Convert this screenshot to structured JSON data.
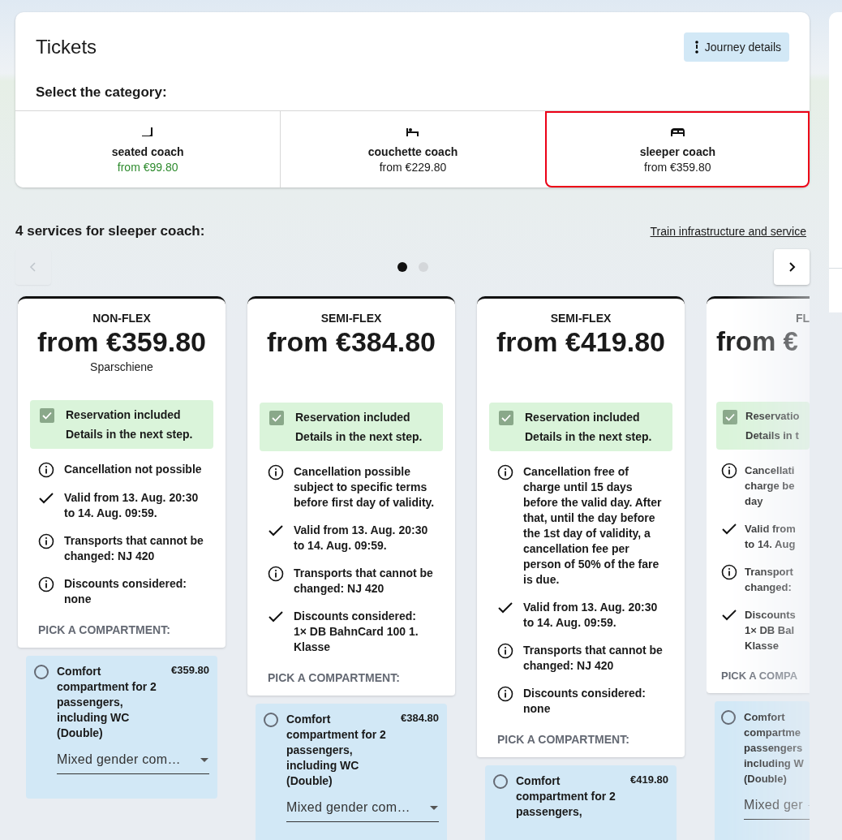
{
  "header": {
    "title": "Tickets",
    "journey_button": "Journey details",
    "category_prompt": "Select the category:"
  },
  "categories": [
    {
      "kind": "seat",
      "name": "seated coach",
      "price": "from €99.80",
      "best_price": true,
      "selected": false
    },
    {
      "kind": "couchette",
      "name": "couchette coach",
      "price": "from €229.80",
      "best_price": false,
      "selected": false
    },
    {
      "kind": "sleeper",
      "name": "sleeper coach",
      "price": "from €359.80",
      "best_price": false,
      "selected": true
    }
  ],
  "services": {
    "heading": "4 services for sleeper coach:",
    "link": "Train infrastructure and service",
    "prev_disabled": true,
    "next_disabled": false,
    "page_dots": [
      {
        "selected": true
      },
      {
        "selected": false
      }
    ]
  },
  "offers": [
    {
      "tier": "NON-FLEX",
      "price": "from €359.80",
      "subtitle": "Sparschiene",
      "faded": false,
      "reservation": {
        "checked": true,
        "title": "Reservation included",
        "note": "Details in the next step."
      },
      "features": [
        {
          "kind": "info",
          "text": "Cancellation not possible"
        },
        {
          "kind": "check",
          "text": "Valid from 13. Aug. 20:30 to 14. Aug. 09:59."
        },
        {
          "kind": "info",
          "text": "Transports that cannot be changed: NJ 420"
        },
        {
          "kind": "info",
          "text": "Discounts considered: none"
        }
      ],
      "compartment_label": "PICK A COMPARTMENT:",
      "compartments": [
        {
          "name": "Comfort compartment for 2 passengers, including WC (Double)",
          "price": "€359.80",
          "selected": false,
          "option": "Mixed gender com…"
        }
      ]
    },
    {
      "tier": "SEMI-FLEX",
      "price": "from €384.80",
      "faded": false,
      "reservation": {
        "checked": true,
        "title": "Reservation included",
        "note": "Details in the next step."
      },
      "features": [
        {
          "kind": "info",
          "text": "Cancellation possible subject to specific terms before first day of validity."
        },
        {
          "kind": "check",
          "text": "Valid from 13. Aug. 20:30 to 14. Aug. 09:59."
        },
        {
          "kind": "info",
          "text": "Transports that cannot be changed: NJ 420"
        },
        {
          "kind": "check",
          "text": "Discounts considered:\n1× DB BahnCard 100 1. Klasse"
        }
      ],
      "compartment_label": "PICK A COMPARTMENT:",
      "compartments": [
        {
          "name": "Comfort compartment for 2 passengers, including WC (Double)",
          "price": "€384.80",
          "selected": false,
          "option": "Mixed gender com…"
        }
      ]
    },
    {
      "tier": "SEMI-FLEX",
      "price": "from €419.80",
      "faded": false,
      "reservation": {
        "checked": true,
        "title": "Reservation included",
        "note": "Details in the next step."
      },
      "features": [
        {
          "kind": "info",
          "text": "Cancellation free of charge until 15 days before the valid day. After that, until the day before the 1st day of validity, a cancellation fee per person of 50% of the fare is due."
        },
        {
          "kind": "check",
          "text": "Valid from 13. Aug. 20:30 to 14. Aug. 09:59."
        },
        {
          "kind": "info",
          "text": "Transports that cannot be changed: NJ 420"
        },
        {
          "kind": "info",
          "text": "Discounts considered: none"
        }
      ],
      "compartment_label": "PICK A COMPARTMENT:",
      "compartments": [
        {
          "name": "Comfort compartment for 2 passengers,",
          "price": "€419.80",
          "selected": false
        }
      ]
    },
    {
      "tier": "FL",
      "price": "from €",
      "faded": true,
      "reservation": {
        "checked": true,
        "title": "Reservatio",
        "note": "Details in t"
      },
      "features": [
        {
          "kind": "info",
          "text": "Cancellati\ncharge be\nday"
        },
        {
          "kind": "check",
          "text": "Valid from\nto 14. Aug"
        },
        {
          "kind": "info",
          "text": "Transport\nchanged:"
        },
        {
          "kind": "check",
          "text": "Discounts\n1× DB Bal\nKlasse"
        }
      ],
      "compartment_label": "PICK A COMPA",
      "compartments": [
        {
          "name": "Comfort\ncompartme\npassengers\nincluding W\n(Double)",
          "selected": false,
          "option": "Mixed ger"
        }
      ]
    }
  ]
}
